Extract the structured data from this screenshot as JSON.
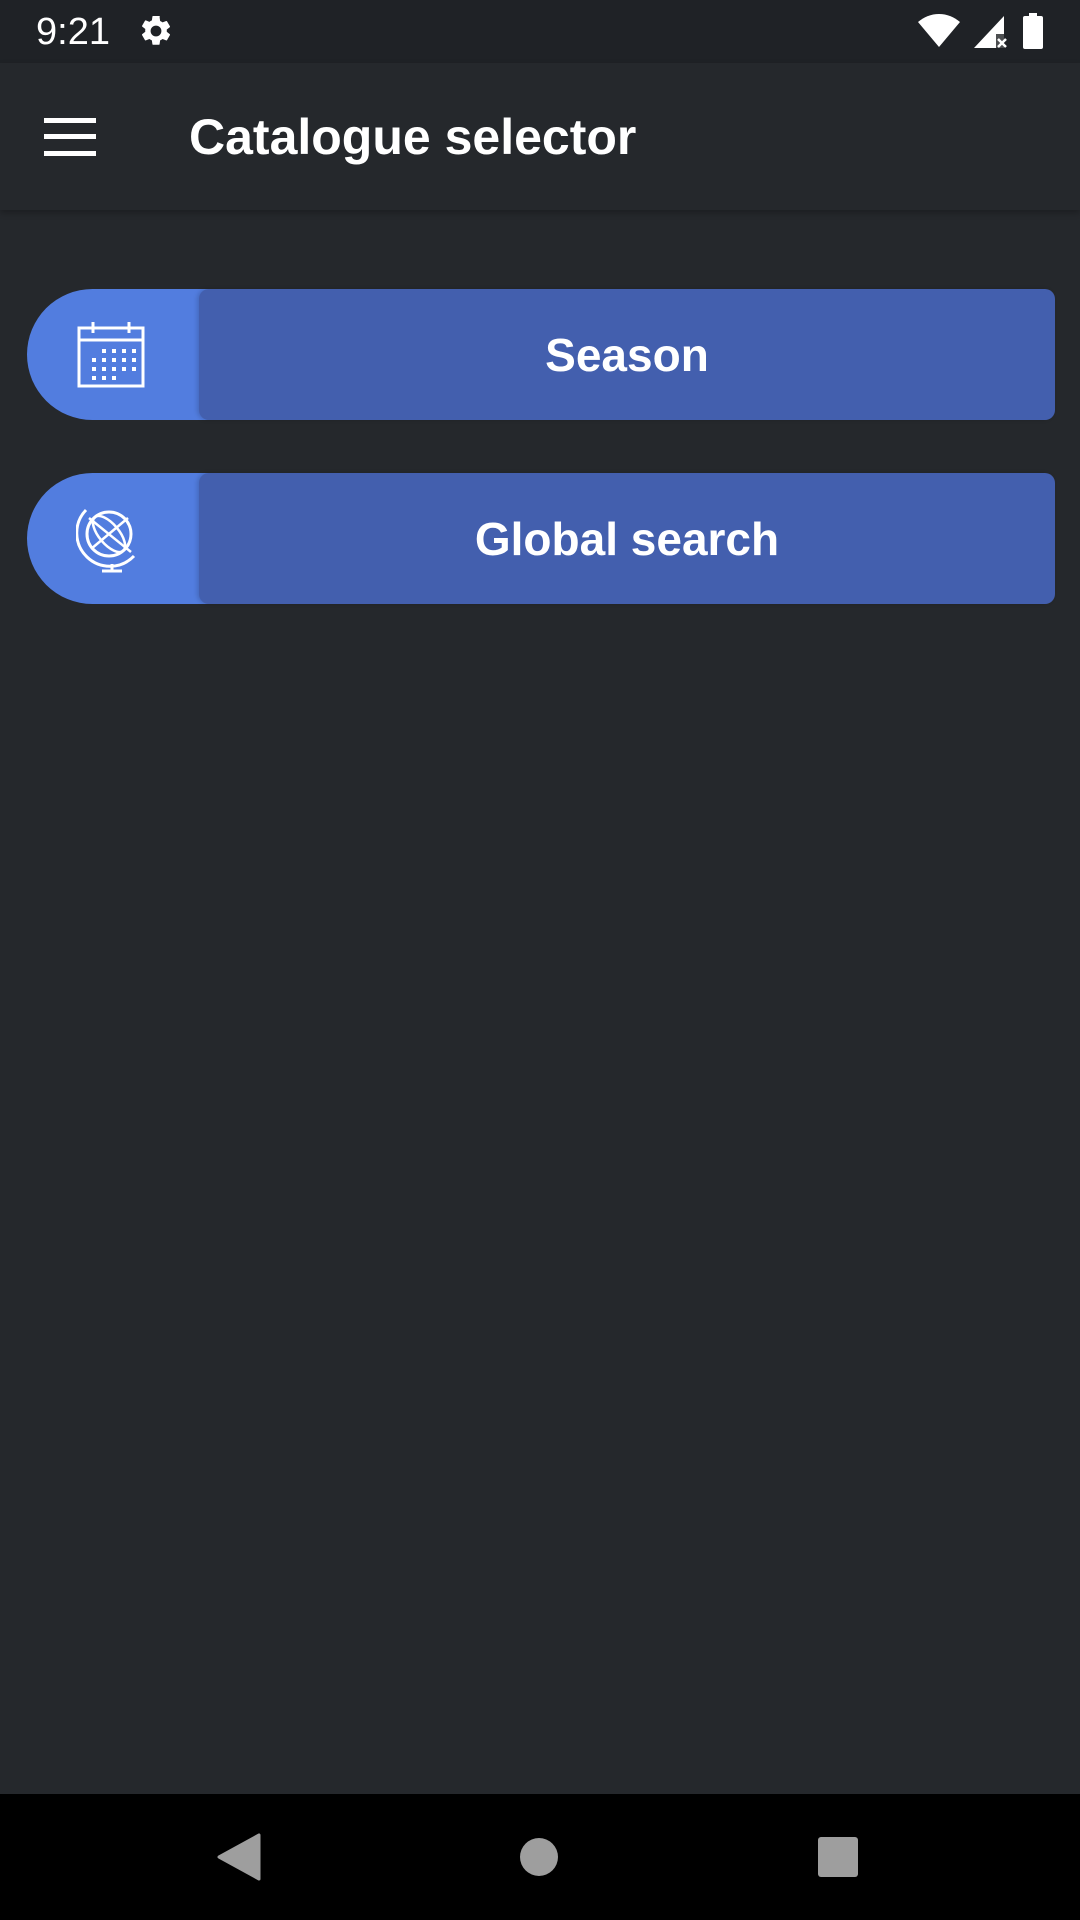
{
  "status_bar": {
    "time": "9:21",
    "icons": [
      "settings-gear-icon",
      "wifi-icon",
      "cell-signal-no-data-icon",
      "battery-icon"
    ]
  },
  "app_bar": {
    "title": "Catalogue selector",
    "menu_icon": "hamburger-menu-icon"
  },
  "catalogue_options": [
    {
      "label": "Season",
      "icon": "calendar-icon"
    },
    {
      "label": "Global search",
      "icon": "globe-icon"
    }
  ],
  "nav_bar": {
    "icons": [
      "back-icon",
      "home-icon",
      "recents-icon"
    ]
  },
  "colors": {
    "background": "#25282c",
    "status_bar": "#1f2226",
    "icon_section": "#527ddf",
    "label_section": "#435fae",
    "text": "#ffffff",
    "nav_icons": "#9e9e9e"
  }
}
